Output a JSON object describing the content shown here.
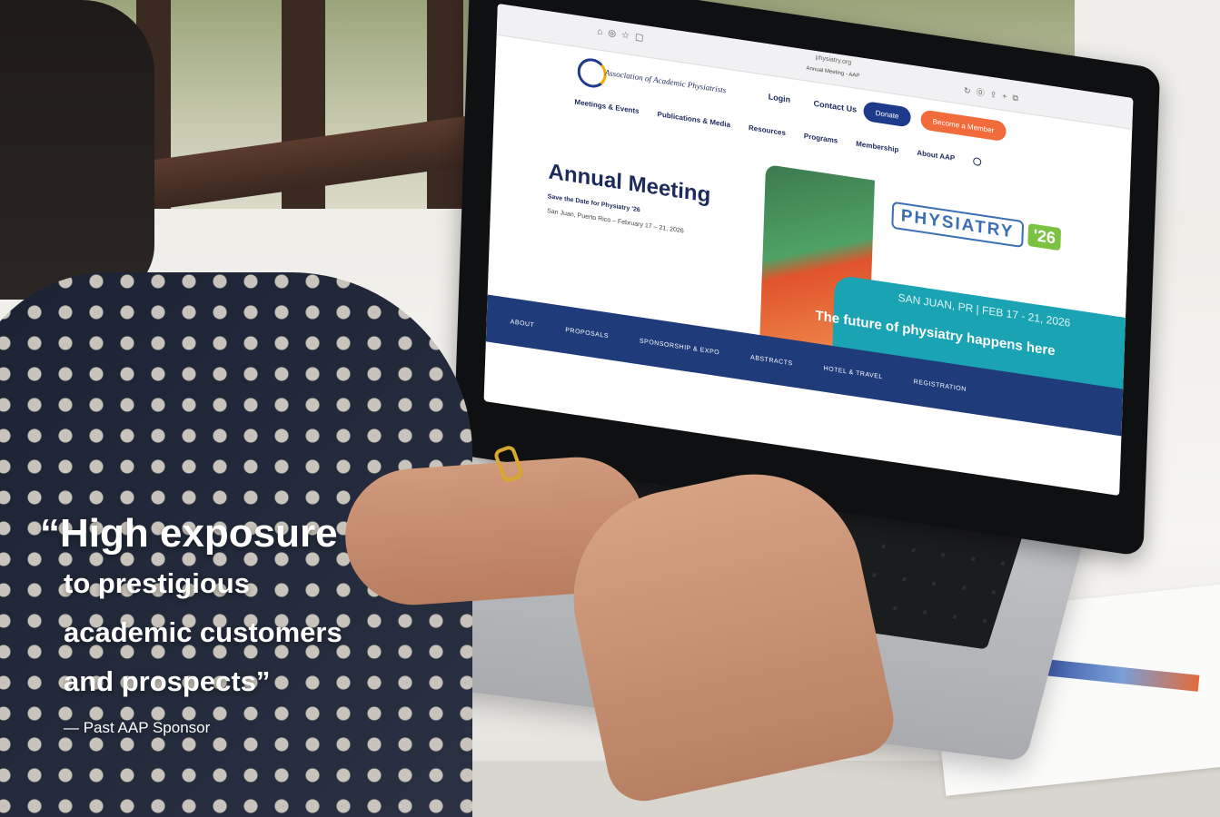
{
  "browser": {
    "url": "physiatry.org",
    "tab_title": "Annual Meeting - AAP"
  },
  "site": {
    "logo_text": "Association of Academic Physiatrists",
    "login": "Login",
    "contact": "Contact Us",
    "donate": "Donate",
    "member": "Become a Member",
    "nav": [
      "Meetings & Events",
      "Publications & Media",
      "Resources",
      "Programs",
      "Membership",
      "About AAP"
    ],
    "hero_title": "Annual Meeting",
    "hero_sub": "Save the Date for Physiatry '26",
    "hero_date": "San Juan, Puerto Rico – February 17 – 21, 2026",
    "banner_word": "PHYSIATRY",
    "banner_year": "'26",
    "banner_location": "SAN JUAN, PR | FEB 17 - 21, 2026",
    "banner_tagline": "The future of physiatry happens here",
    "subnav": [
      "ABOUT",
      "PROPOSALS",
      "SPONSORSHIP & EXPO",
      "ABSTRACTS",
      "HOTEL & TRAVEL",
      "REGISTRATION"
    ]
  },
  "quote": {
    "line1": "“High exposure",
    "line2": "to prestigious",
    "line3": "academic customers",
    "line4": "and prospects”",
    "attribution": "— Past AAP Sponsor"
  }
}
